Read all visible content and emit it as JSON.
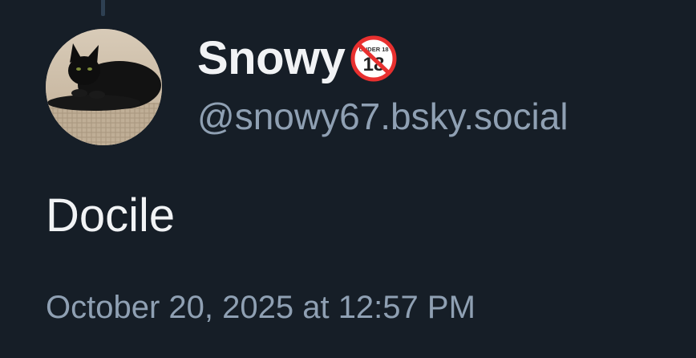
{
  "post": {
    "author": {
      "display_name": "Snowy",
      "badge_emoji": "no-one-under-eighteen",
      "badge_text": "UNDER 18",
      "handle": "@snowy67.bsky.social",
      "avatar_icon": "black-cat-avatar"
    },
    "text": "Docile",
    "timestamp": "October 20, 2025 at 12:57 PM"
  },
  "colors": {
    "background": "#161e27",
    "primary_text": "#f1f3f5",
    "secondary_text": "#8fa0b3",
    "thread_line": "#2e4052",
    "badge_red": "#e8302f"
  }
}
